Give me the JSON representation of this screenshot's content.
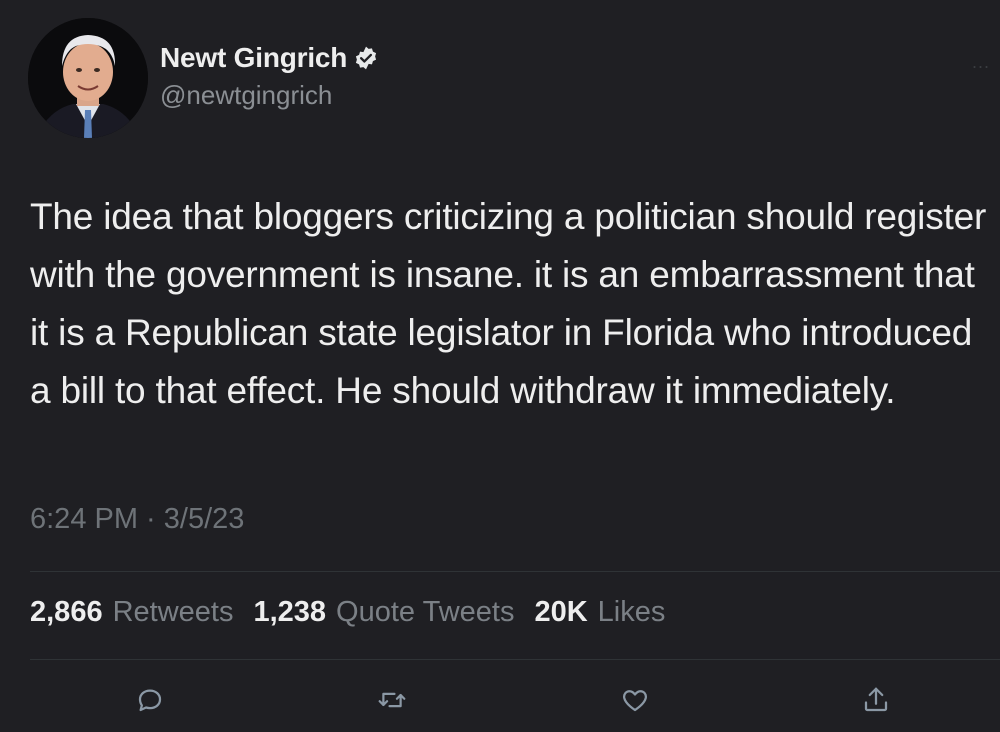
{
  "user": {
    "display_name": "Newt Gingrich",
    "handle": "@newtgingrich",
    "verified": true,
    "avatar_icon": "user-avatar"
  },
  "more_label": "...",
  "tweet": {
    "text": "The idea that bloggers criticizing a politician should register with the government is insane. it is an embarrassment that it is a Republican state legislator in Florida who introduced a bill to that effect. He should withdraw it immediately.",
    "timestamp": "6:24 PM · 3/5/23"
  },
  "stats": {
    "retweets_count": "2,866",
    "retweets_label": "Retweets",
    "quotes_count": "1,238",
    "quotes_label": "Quote Tweets",
    "likes_count": "20K",
    "likes_label": "Likes"
  },
  "actions": [
    "reply-icon",
    "retweet-icon",
    "like-icon",
    "share-icon"
  ],
  "colors": {
    "background": "#1f1f23",
    "text": "#eeeeee",
    "muted": "#7b8086",
    "verified": "#e7e9ea"
  }
}
